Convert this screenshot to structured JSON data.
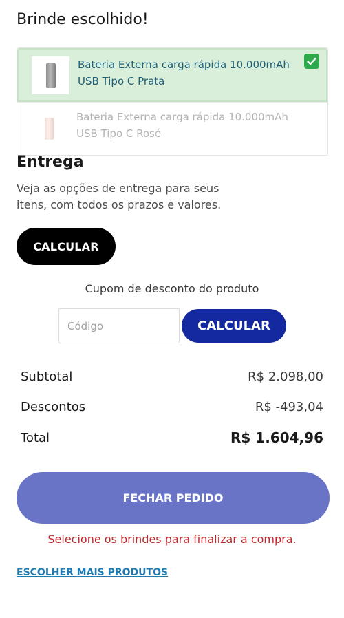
{
  "gift_section": {
    "title": "Brinde escolhido!",
    "items": [
      {
        "name": "Bateria Externa carga rápida 10.000mAh USB Tipo C Prata",
        "selected": true
      },
      {
        "name": "Bateria Externa carga rápida 10.000mAh USB Tipo C Rosé",
        "selected": false
      }
    ]
  },
  "delivery": {
    "title": "Entrega",
    "description": "Veja as opções de entrega para seus itens, com todos os prazos e valores.",
    "calc_button": "CALCULAR"
  },
  "coupon": {
    "label": "Cupom de desconto do produto",
    "placeholder": "Código",
    "value": "",
    "calc_button": "CALCULAR"
  },
  "summary": {
    "subtotal_label": "Subtotal",
    "subtotal_value": "R$ 2.098,00",
    "discounts_label": "Descontos",
    "discounts_value": "R$ -493,04",
    "total_label": "Total",
    "total_value": "R$ 1.604,96"
  },
  "checkout": {
    "button": "FECHAR PEDIDO",
    "warning": "Selecione os brindes para finalizar a compra.",
    "more_products_link": "ESCOLHER MAIS PRODUTOS"
  },
  "colors": {
    "selected_bg": "#d9efd9",
    "check_green": "#2eaa4c",
    "primary_blue": "#1428a0",
    "checkout_button": "#6a74c6",
    "warning_red": "#c0262d",
    "link_blue": "#1e7ab0"
  },
  "icons": {
    "check": "check-icon"
  }
}
